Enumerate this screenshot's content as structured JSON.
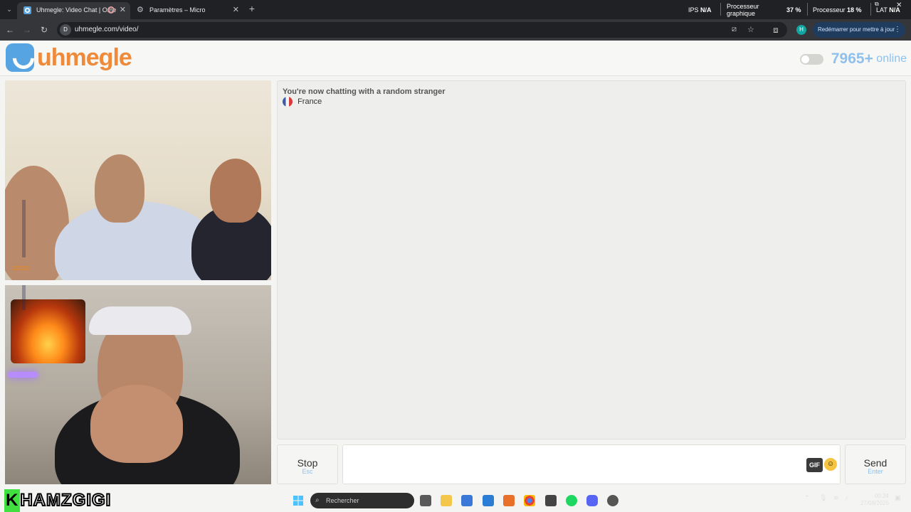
{
  "browser": {
    "tabs": [
      {
        "title": "Uhmegle: Video Chat | Ome",
        "active": true
      },
      {
        "title": "Paramètres – Micro",
        "active": false
      }
    ],
    "url": "uhmegle.com/video/",
    "site_badge": "D",
    "profile_initial": "H",
    "restart_label": "Redémarrer pour mettre à jour"
  },
  "perf_overlay": {
    "ips_label": "IPS",
    "ips_value": "N/A",
    "gpu_label": "Processeur graphique",
    "gpu_value": "37 %",
    "cpu_label": "Processeur",
    "cpu_value": "18 %",
    "lat_label": "LAT",
    "lat_value": "N/A"
  },
  "site": {
    "logo_text": "uhmegle",
    "online_count": "7965+",
    "online_label": "online"
  },
  "chat": {
    "intro": "You're now chatting with a random stranger",
    "country": "France"
  },
  "controls": {
    "stop_label": "Stop",
    "stop_hint": "Esc",
    "gif_label": "GIF",
    "send_label": "Send",
    "send_hint": "Enter"
  },
  "stream": {
    "name_first": "K",
    "name_rest": "HAMZGIGI"
  },
  "taskbar": {
    "search_placeholder": "Rechercher",
    "time": "00:24",
    "date": "27/08/2025"
  },
  "colors": {
    "accent_blue": "#8fc1ec",
    "logo_orange": "#ef8a3b"
  }
}
